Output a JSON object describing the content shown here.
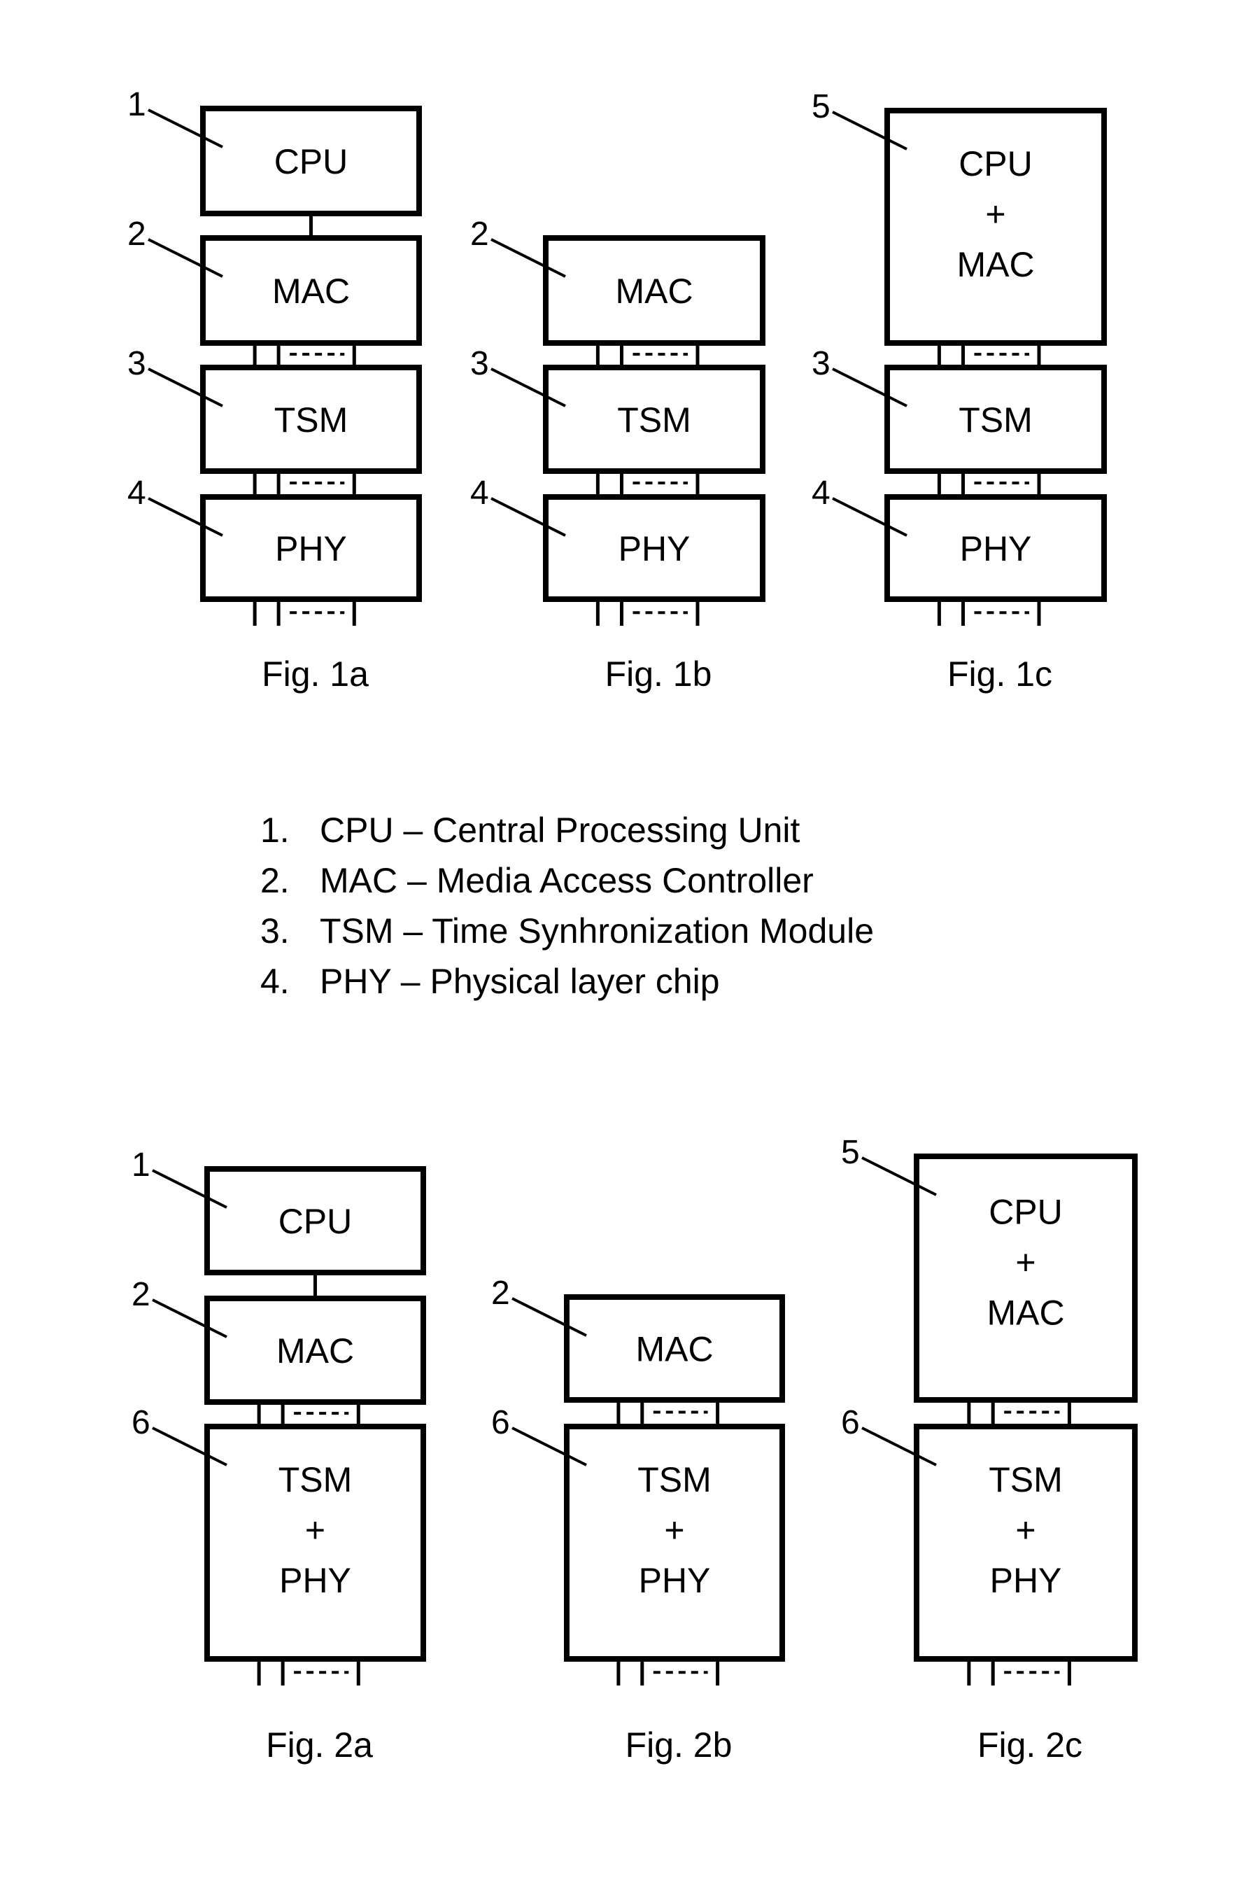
{
  "figures": [
    {
      "caption": "Fig. 1a",
      "blocks": [
        {
          "ref": "1",
          "lines": [
            "CPU"
          ]
        },
        {
          "ref": "2",
          "lines": [
            "MAC"
          ]
        },
        {
          "ref": "3",
          "lines": [
            "TSM"
          ]
        },
        {
          "ref": "4",
          "lines": [
            "PHY"
          ]
        }
      ],
      "links": [
        "single",
        "bus",
        "bus"
      ],
      "bottom_bus": true
    },
    {
      "caption": "Fig. 1b",
      "blocks": [
        {
          "ref": "2",
          "lines": [
            "MAC"
          ]
        },
        {
          "ref": "3",
          "lines": [
            "TSM"
          ]
        },
        {
          "ref": "4",
          "lines": [
            "PHY"
          ]
        }
      ],
      "links": [
        "bus",
        "bus"
      ],
      "bottom_bus": true
    },
    {
      "caption": "Fig. 1c",
      "blocks": [
        {
          "ref": "5",
          "lines": [
            "CPU",
            "+",
            "MAC"
          ]
        },
        {
          "ref": "3",
          "lines": [
            "TSM"
          ]
        },
        {
          "ref": "4",
          "lines": [
            "PHY"
          ]
        }
      ],
      "links": [
        "bus",
        "bus"
      ],
      "bottom_bus": true
    },
    {
      "caption": "Fig. 2a",
      "blocks": [
        {
          "ref": "1",
          "lines": [
            "CPU"
          ]
        },
        {
          "ref": "2",
          "lines": [
            "MAC"
          ]
        },
        {
          "ref": "6",
          "lines": [
            "TSM",
            "+",
            "PHY"
          ]
        }
      ],
      "links": [
        "single",
        "bus"
      ],
      "bottom_bus": true
    },
    {
      "caption": "Fig. 2b",
      "blocks": [
        {
          "ref": "2",
          "lines": [
            "MAC"
          ]
        },
        {
          "ref": "6",
          "lines": [
            "TSM",
            "+",
            "PHY"
          ]
        }
      ],
      "links": [
        "bus"
      ],
      "bottom_bus": true
    },
    {
      "caption": "Fig. 2c",
      "blocks": [
        {
          "ref": "5",
          "lines": [
            "CPU",
            "+",
            "MAC"
          ]
        },
        {
          "ref": "6",
          "lines": [
            "TSM",
            "+",
            "PHY"
          ]
        }
      ],
      "links": [
        "bus"
      ],
      "bottom_bus": true
    }
  ],
  "legend": [
    {
      "num": "1.",
      "text": "CPU – Central Processing Unit"
    },
    {
      "num": "2.",
      "text": "MAC – Media Access Controller"
    },
    {
      "num": "3.",
      "text": "TSM – Time Synhronization Module"
    },
    {
      "num": "4.",
      "text": "PHY – Physical layer chip"
    }
  ]
}
